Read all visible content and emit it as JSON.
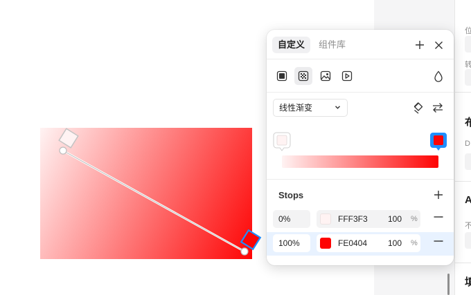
{
  "popover": {
    "tabs": [
      {
        "label": "自定义",
        "active": true
      },
      {
        "label": "组件库",
        "active": false
      }
    ],
    "fill_types": [
      "solid-fill-icon",
      "gradient-fill-icon",
      "image-fill-icon",
      "video-fill-icon"
    ],
    "gradient_select": {
      "value": "线性渐变"
    },
    "stops_title": "Stops",
    "stops": [
      {
        "position": "0%",
        "hex": "FFF3F3",
        "color": "#FFF3F3",
        "opacity": "100",
        "unit": "%"
      },
      {
        "position": "100%",
        "hex": "FE0404",
        "color": "#FE0404",
        "opacity": "100",
        "unit": "%"
      }
    ]
  },
  "colors": {
    "accent": "#1F8FFF",
    "stop_start": "#FFF3F3",
    "stop_end": "#FE0404",
    "selected_row": "#E8F2FF"
  },
  "side_panel": {
    "fragments": [
      "位",
      "转",
      "布",
      "D",
      "A",
      "不",
      "填"
    ]
  }
}
